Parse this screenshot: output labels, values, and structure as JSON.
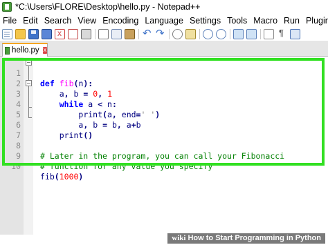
{
  "window": {
    "title": "*C:\\Users\\FLORE\\Desktop\\hello.py - Notepad++"
  },
  "menu": [
    "File",
    "Edit",
    "Search",
    "View",
    "Encoding",
    "Language",
    "Settings",
    "Tools",
    "Macro",
    "Run",
    "Plugins"
  ],
  "toolbar": {
    "icons": [
      "new-file-icon",
      "open-file-icon",
      "save-icon",
      "save-all-icon",
      "close-icon",
      "close-all-icon",
      "print-icon",
      "cut-icon",
      "copy-icon",
      "paste-icon",
      "undo-icon",
      "redo-icon",
      "find-icon",
      "replace-icon",
      "zoom-in-icon",
      "zoom-out-icon",
      "sync-vertical-icon",
      "sync-horizontal-icon",
      "word-wrap-icon",
      "show-all-characters-icon",
      "indent-guide-icon"
    ]
  },
  "tab": {
    "label": "hello.py",
    "close": "x"
  },
  "editor": {
    "lines": [
      {
        "n": "1",
        "text": "def fib(n):"
      },
      {
        "n": "2",
        "text": "    a, b = 0, 1"
      },
      {
        "n": "3",
        "text": "    while a < n:"
      },
      {
        "n": "4",
        "text": "        print(a, end=' ')"
      },
      {
        "n": "5",
        "text": "        a, b = b, a+b"
      },
      {
        "n": "6",
        "text": "    print()"
      },
      {
        "n": "7",
        "text": ""
      },
      {
        "n": "8",
        "text": "# Later in the program, you can call your Fibonacci"
      },
      {
        "n": "9",
        "text": "# function for any value you specify"
      },
      {
        "n": "10",
        "text": "fib(1000)"
      }
    ]
  },
  "colors": {
    "highlight_border": "#32e022",
    "keyword": "#0000ff",
    "number": "#ff0000",
    "comment": "#008000",
    "string": "#808080",
    "tab_accent": "#f5a623"
  },
  "watermark": {
    "logo": "wiki",
    "text": "How to Start Programming in Python"
  }
}
